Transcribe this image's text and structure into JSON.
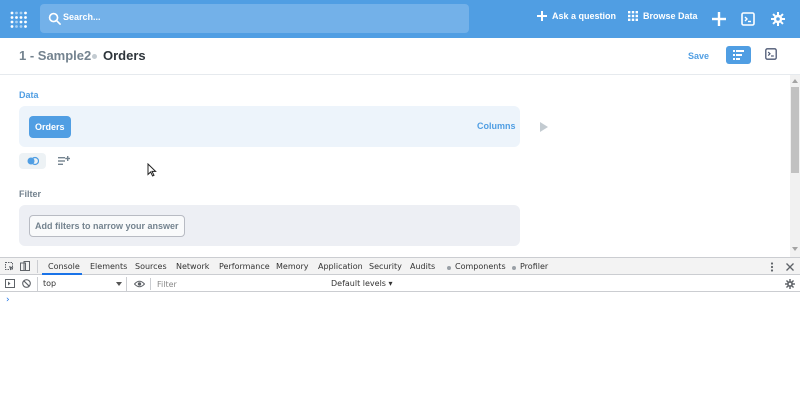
{
  "nav": {
    "search_placeholder": "Search...",
    "ask_question": "Ask a question",
    "browse_data": "Browse Data"
  },
  "header": {
    "collection": "1 - Sample2",
    "title": "Orders",
    "save_label": "Save"
  },
  "notebook": {
    "data_label": "Data",
    "table_name": "Orders",
    "columns_label": "Columns",
    "filter_label": "Filter",
    "filter_placeholder": "Add filters to narrow your answer"
  },
  "devtools": {
    "tabs": [
      "Console",
      "Elements",
      "Sources",
      "Network",
      "Performance",
      "Memory",
      "Application",
      "Security",
      "Audits",
      "Components",
      "Profiler"
    ],
    "context": "top",
    "filter_placeholder": "Filter",
    "levels": "Default levels ▾",
    "prompt": "›"
  },
  "colors": {
    "brand": "#509ee3",
    "brand_light": "#73b1e9",
    "devtools_active": "#1a73e8"
  }
}
